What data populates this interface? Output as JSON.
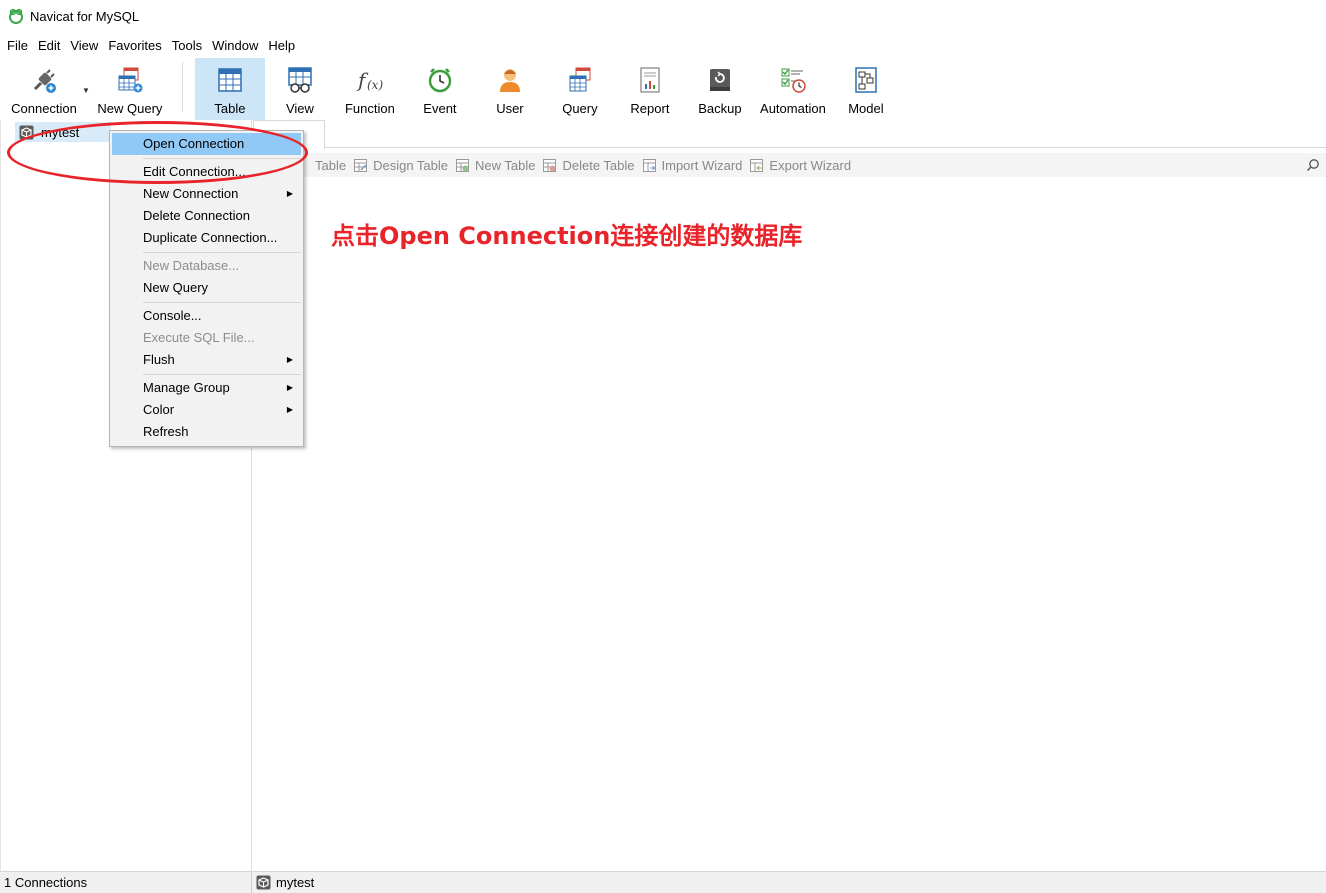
{
  "window": {
    "title": "Navicat for MySQL"
  },
  "menubar": {
    "items": [
      "File",
      "Edit",
      "View",
      "Favorites",
      "Tools",
      "Window",
      "Help"
    ]
  },
  "toolbar": {
    "buttons": [
      {
        "label": "Connection",
        "icon": "connection-plug-icon"
      },
      {
        "label": "New Query",
        "icon": "new-query-icon"
      },
      {
        "label": "Table",
        "icon": "table-icon",
        "active": true
      },
      {
        "label": "View",
        "icon": "view-icon"
      },
      {
        "label": "Function",
        "icon": "function-icon"
      },
      {
        "label": "Event",
        "icon": "event-clock-icon"
      },
      {
        "label": "User",
        "icon": "user-icon"
      },
      {
        "label": "Query",
        "icon": "query-icon"
      },
      {
        "label": "Report",
        "icon": "report-icon"
      },
      {
        "label": "Backup",
        "icon": "backup-icon"
      },
      {
        "label": "Automation",
        "icon": "automation-icon"
      },
      {
        "label": "Model",
        "icon": "model-icon"
      }
    ]
  },
  "sidebar": {
    "connection_name": "mytest"
  },
  "object_toolbar": {
    "items": [
      "Table",
      "Design Table",
      "New Table",
      "Delete Table",
      "Import Wizard",
      "Export Wizard"
    ]
  },
  "context_menu": {
    "items": [
      {
        "label": "Open Connection",
        "highlighted": true
      },
      {
        "separator": true
      },
      {
        "label": "Edit Connection..."
      },
      {
        "label": "New Connection",
        "submenu": true
      },
      {
        "label": "Delete Connection"
      },
      {
        "label": "Duplicate Connection..."
      },
      {
        "separator": true
      },
      {
        "label": "New Database...",
        "disabled": true
      },
      {
        "label": "New Query"
      },
      {
        "separator": true
      },
      {
        "label": "Console..."
      },
      {
        "label": "Execute SQL File...",
        "disabled": true
      },
      {
        "label": "Flush",
        "submenu": true
      },
      {
        "separator": true
      },
      {
        "label": "Manage Group",
        "submenu": true
      },
      {
        "label": "Color",
        "submenu": true
      },
      {
        "label": "Refresh"
      }
    ]
  },
  "annotation": {
    "text": "点击Open Connection连接创建的数据库",
    "color": "#e8242a"
  },
  "statusbar": {
    "left": "1 Connections",
    "right": "mytest"
  },
  "colors": {
    "accent": "#90c8f6",
    "selected_tree": "#d9ebf9",
    "active_tool": "#cde6f7",
    "annotation_red": "#e8242a"
  }
}
